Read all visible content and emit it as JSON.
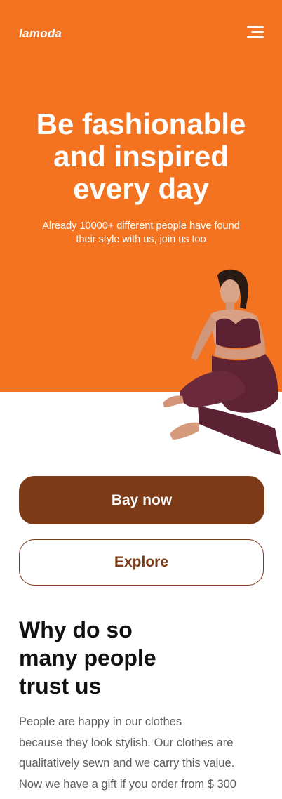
{
  "header": {
    "logo": "lamoda",
    "menu_icon": "hamburger-menu-icon"
  },
  "hero": {
    "title_lines": [
      "Be fashionable",
      "and inspired",
      "every day"
    ],
    "subtitle_lines": [
      "Already 10000+ different people have found",
      "their style with us, join us too"
    ],
    "background_color": "#f47321"
  },
  "actions": {
    "primary_label": "Bay now",
    "secondary_label": "Explore",
    "accent_color": "#7c3a17"
  },
  "trust_section": {
    "title_lines": [
      "Why do so",
      "many people",
      "trust us"
    ],
    "body_lines": [
      "People are happy in our clothes",
      "because they look stylish. Our clothes are",
      "qualitatively sewn and we carry this value.",
      "Now we have a gift if you order from $ 300"
    ]
  }
}
